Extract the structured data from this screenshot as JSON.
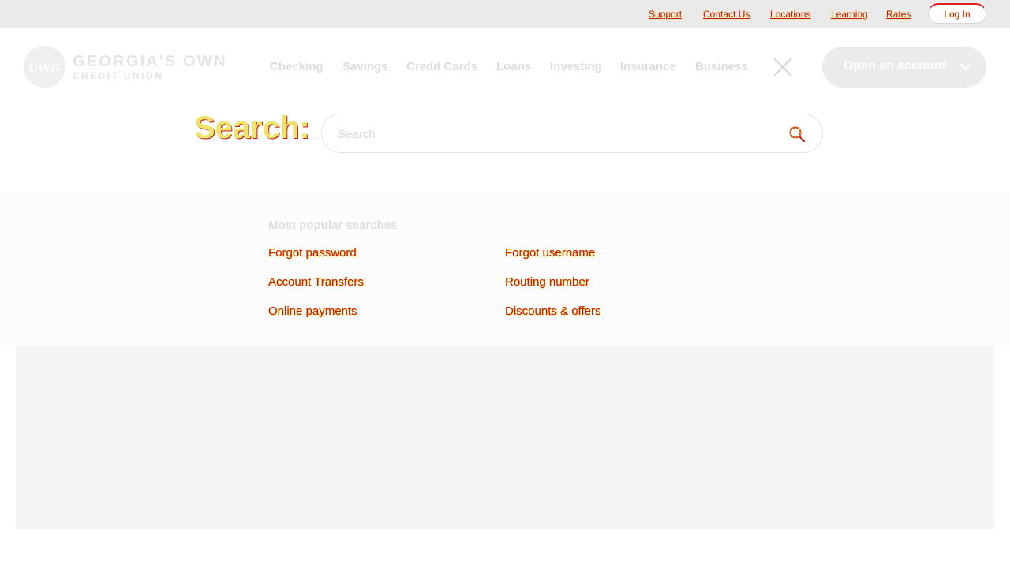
{
  "utility_nav": {
    "links": [
      "Support",
      "Contact Us",
      "Locations",
      "Learning",
      "Rates"
    ],
    "login_label": "Log In"
  },
  "brand": {
    "logo_mark": "own",
    "name_line1": "GEORGIA'S OWN",
    "name_line2": "CREDIT UNION"
  },
  "main_nav": {
    "items": [
      "Checking",
      "Savings",
      "Credit Cards",
      "Loans",
      "Investing",
      "Insurance",
      "Business"
    ],
    "close_icon": "close-icon",
    "open_account_label": "Open an account",
    "open_account_icon": "chevron-down-icon"
  },
  "search": {
    "label": "Search:",
    "placeholder": "Search",
    "value": "",
    "icon": "search-icon"
  },
  "popular": {
    "heading": "Most popular searches",
    "links": [
      "Forgot password",
      "Forgot username",
      "Account Transfers",
      "Routing number",
      "Online payments",
      "Discounts & offers"
    ]
  },
  "colors": {
    "link": "#c41a1a",
    "utility_bar": "#eaeaea",
    "search_label": "#ede56a",
    "panel": "#fcfcfc",
    "content_area": "#f5f5f5"
  }
}
